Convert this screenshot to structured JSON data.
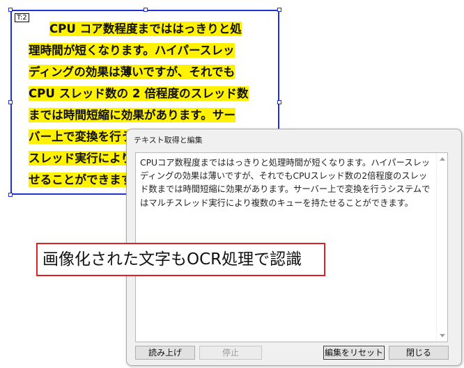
{
  "frame": {
    "tag": "T:2",
    "lines": [
      "CPU コア数程度までははっきりと処",
      "理時間が短くなります。ハイパースレッ",
      "ディングの効果は薄いですが、それでも",
      "CPU スレッド数の 2 倍程度のスレッド数",
      "までは時間短縮に効果があります。サー",
      "バー上で変換を行うシステムではマルチ",
      "スレッド実行により複数のキューを持た",
      "せることができます。"
    ]
  },
  "dialog": {
    "title": "テキスト取得と編集",
    "text": "CPUコア数程度までははっきりと処理時間が短くなります。ハイパースレッディングの効果は薄いですが、それでもCPUスレッド数の2倍程度のスレッド数までは時間短縮に効果があります。サーバー上で変換を行うシステムではマルチスレッド実行により複数のキューを持たせることができます。",
    "buttons": {
      "read_aloud": "読み上げ",
      "stop": "停止",
      "reset_edit": "編集をリセット",
      "close": "閉じる"
    }
  },
  "callout": {
    "text": "画像化された文字もOCR処理で認識"
  },
  "colors": {
    "frame_border": "#1f2fd6",
    "highlight": "#fff200",
    "callout_border": "#e02020"
  }
}
